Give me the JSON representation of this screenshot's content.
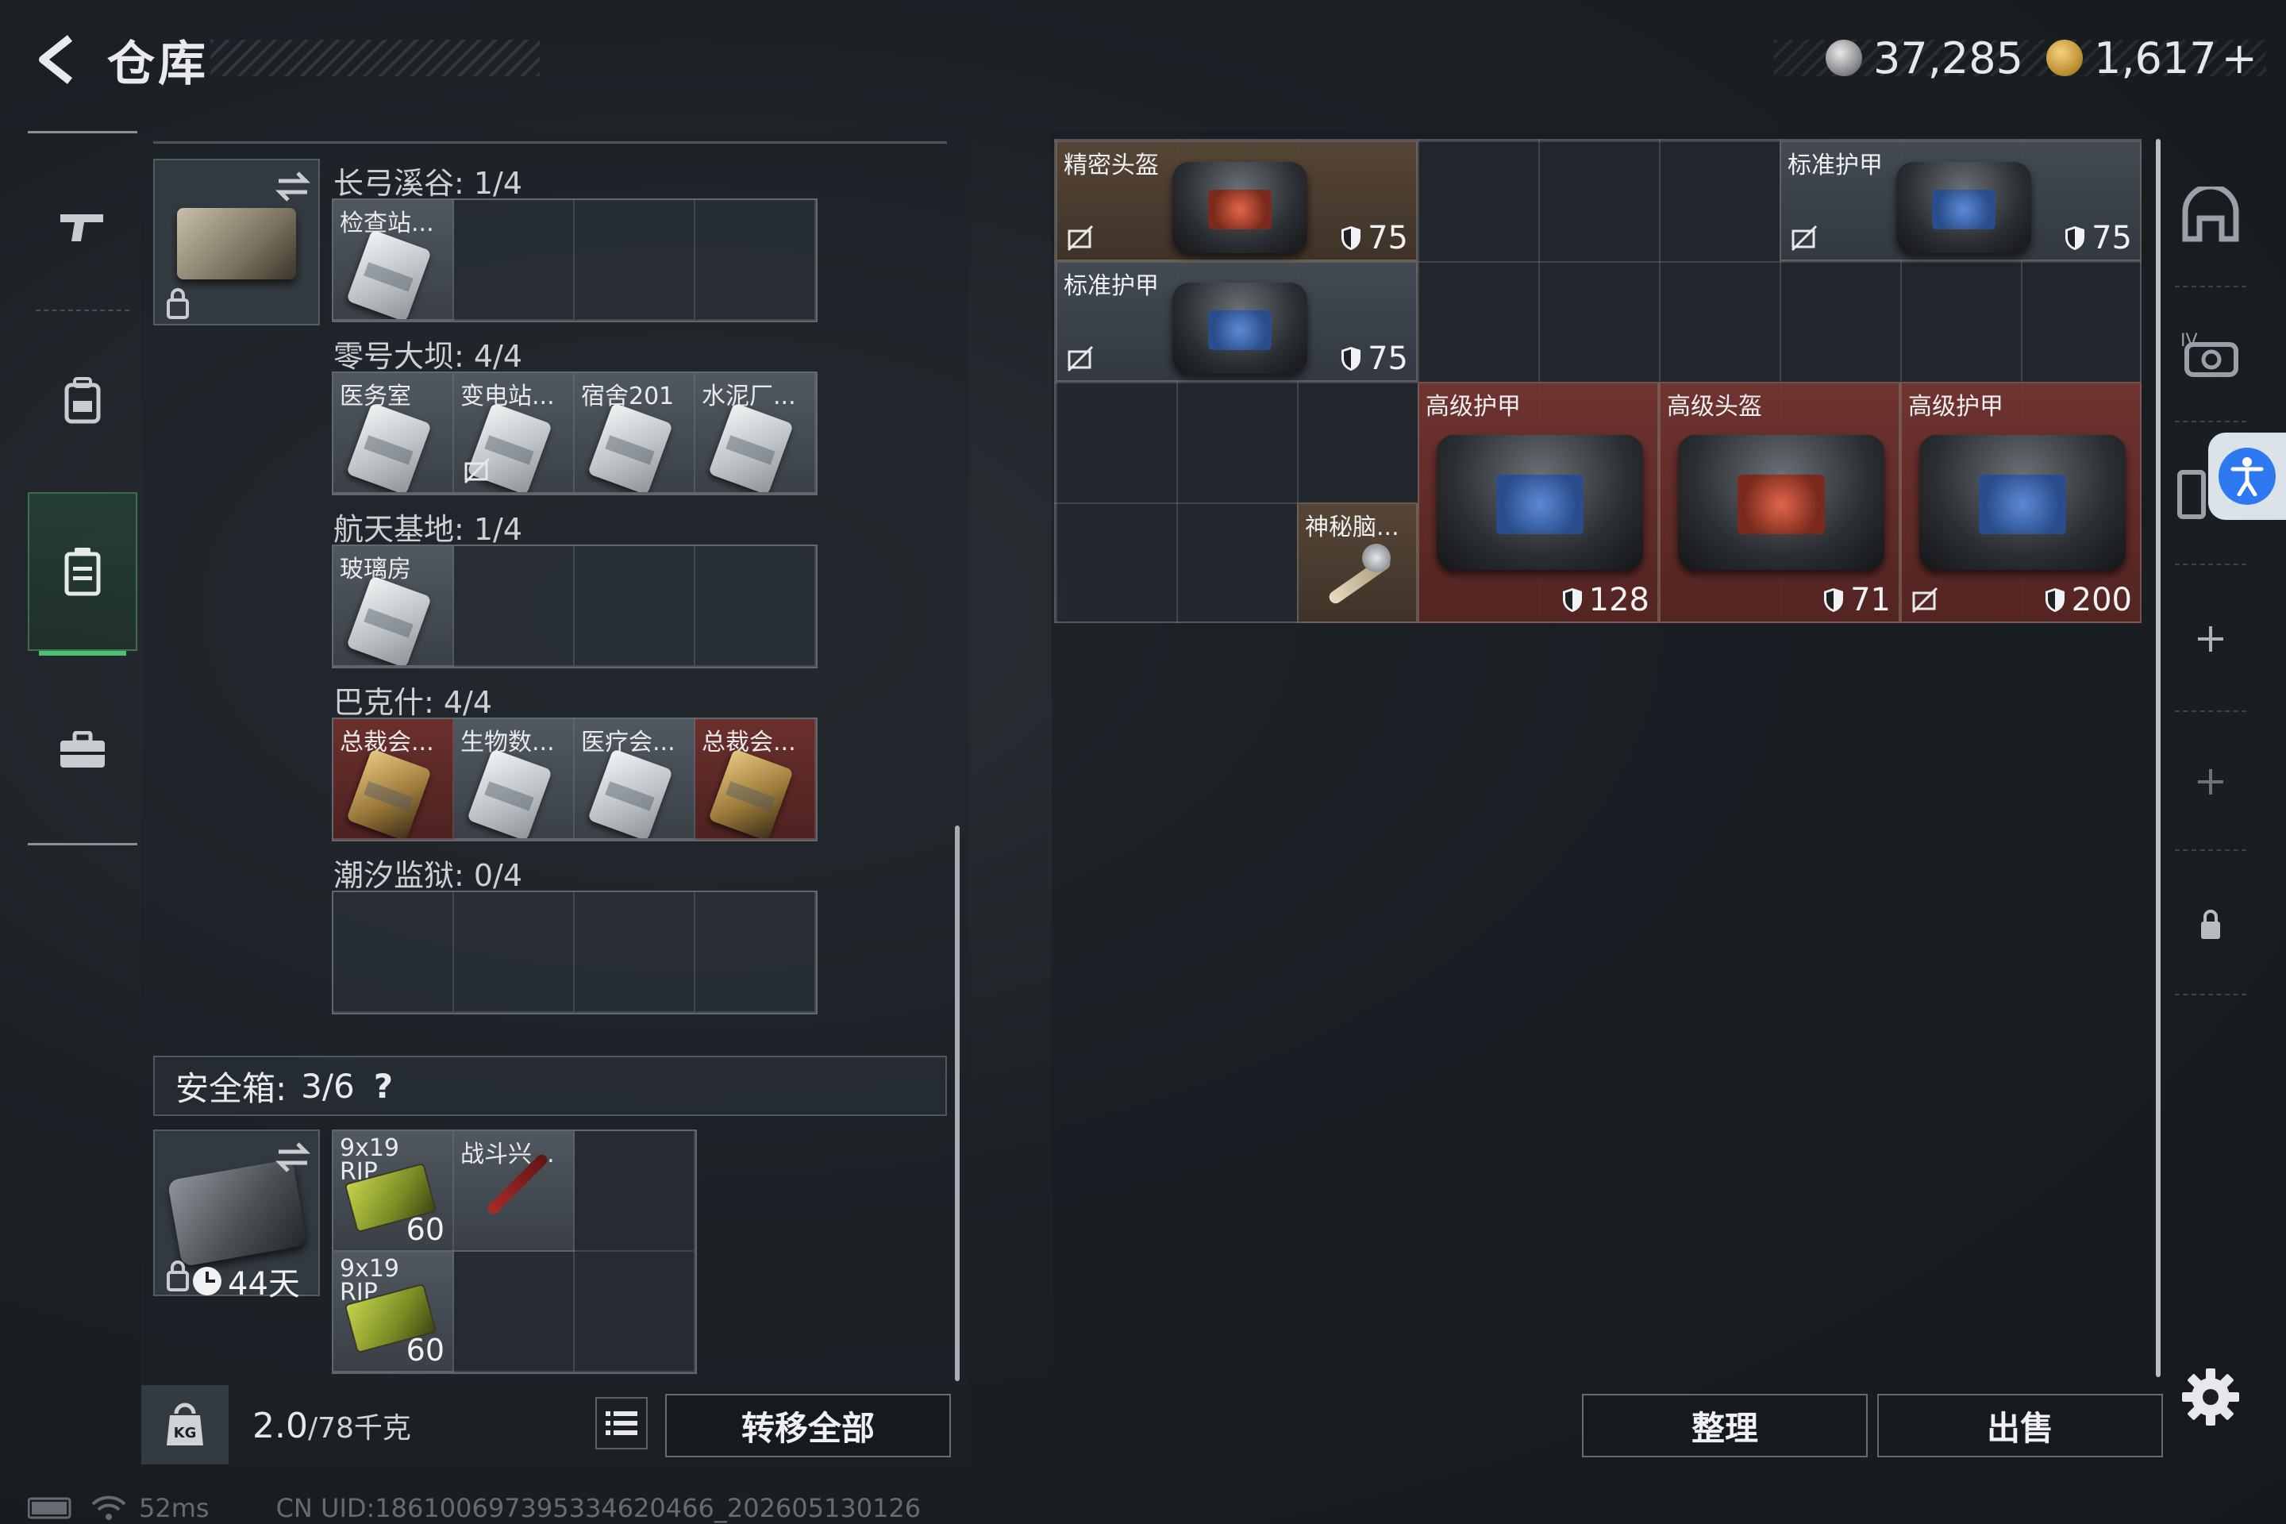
{
  "header": {
    "title": "仓库",
    "currency_a": "37,285",
    "currency_b": "1,617",
    "currency_b_add": "+"
  },
  "keycard_case": {
    "groups": [
      {
        "label": "长弓溪谷: 1/4",
        "items": [
          {
            "name": "检查站...",
            "color": "silver",
            "nosell": false
          }
        ]
      },
      {
        "label": "零号大坝: 4/4",
        "items": [
          {
            "name": "医务室",
            "color": "silver",
            "nosell": false
          },
          {
            "name": "变电站...",
            "color": "silver",
            "nosell": true
          },
          {
            "name": "宿舍201",
            "color": "silver",
            "nosell": false
          },
          {
            "name": "水泥厂...",
            "color": "silver",
            "nosell": false
          }
        ]
      },
      {
        "label": "航天基地: 1/4",
        "items": [
          {
            "name": "玻璃房",
            "color": "silver",
            "nosell": false
          }
        ]
      },
      {
        "label": "巴克什: 4/4",
        "items": [
          {
            "name": "总裁会...",
            "color": "gold",
            "nosell": false
          },
          {
            "name": "生物数...",
            "color": "silver",
            "nosell": false
          },
          {
            "name": "医疗会...",
            "color": "silver",
            "nosell": false
          },
          {
            "name": "总裁会...",
            "color": "gold",
            "nosell": false
          }
        ]
      },
      {
        "label": "潮汐监狱: 0/4",
        "items": []
      }
    ]
  },
  "safe_box": {
    "label": "安全箱:",
    "count": "3/6",
    "help": "?",
    "timer": "44天",
    "items": [
      {
        "name": "9x19",
        "sub": "RIP",
        "qty": "60"
      },
      {
        "name": "战斗兴...",
        "sub": "",
        "qty": ""
      },
      {
        "name": "9x19",
        "sub": "RIP",
        "qty": "60"
      }
    ]
  },
  "bottom_left": {
    "weight": "2.0",
    "weight_max": "/78千克",
    "transfer_all": "转移全部"
  },
  "stash": {
    "items": [
      {
        "name": "精密头盔",
        "durability": "75",
        "nosell": true,
        "color": "brown",
        "screen": "red"
      },
      {
        "name": "标准护甲",
        "durability": "75",
        "nosell": true,
        "color": "gray",
        "screen": "blue"
      },
      {
        "name": "标准护甲",
        "durability": "75",
        "nosell": true,
        "color": "gray",
        "screen": "blue"
      },
      {
        "name": "神秘脑...",
        "durability": "",
        "nosell": false,
        "color": "brown",
        "screen": ""
      },
      {
        "name": "高级护甲",
        "durability": "128",
        "nosell": false,
        "color": "red",
        "screen": "blue"
      },
      {
        "name": "高级头盔",
        "durability": "71",
        "nosell": false,
        "color": "red",
        "screen": "red"
      },
      {
        "name": "高级护甲",
        "durability": "200",
        "nosell": true,
        "color": "red",
        "screen": "blue"
      }
    ],
    "sort_button": "整理",
    "sell_button": "出售"
  },
  "right_sidebar": {
    "items": [
      "helmet-slot-icon",
      "armor-slot-icon",
      "rig-slot-icon",
      "add-slot-icon",
      "add-slot-icon",
      "lock-icon"
    ]
  },
  "status": {
    "ping": "52ms",
    "uid": "CN UID:1861006973953346204​66_202605130126"
  },
  "colors": {
    "accent_green": "#4fbf73",
    "item_red": "#733430",
    "item_brown": "#5a4837",
    "access_blue": "#2f79f0"
  }
}
